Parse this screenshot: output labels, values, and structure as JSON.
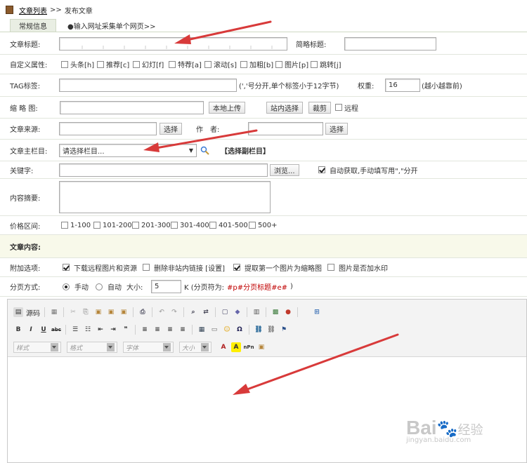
{
  "breadcrumb": {
    "list_link": "文章列表",
    "sep": ">>",
    "current": "发布文章"
  },
  "tabs": [
    {
      "label": "常规信息"
    },
    {
      "label": "●输入网址采集单个网页>>"
    }
  ],
  "fields": {
    "title_label": "文章标题:",
    "short_title_label": "简略标题:",
    "custom_attr_label": "自定义属性:",
    "attrs": [
      "头条[h]",
      "推荐[c]",
      "幻灯[f]",
      "特荐[a]",
      "滚动[s]",
      "加粗[b]",
      "图片[p]",
      "跳转[j]"
    ],
    "tag_label": "TAG标签:",
    "tag_hint": "(','号分开,单个标签小于12字节)",
    "weight_label": "权重:",
    "weight_value": "16",
    "weight_hint": "(越小越靠前)",
    "thumb_label": "缩 略 图:",
    "upload_btn": "本地上传",
    "site_select_btn": "站内选择",
    "crop_btn": "裁剪",
    "remote_label": "远程",
    "source_label": "文章来源:",
    "select_btn": "选择",
    "author_label": "作　者:",
    "category_label": "文章主栏目:",
    "category_value": "请选择栏目...",
    "sub_category_link": "【选择副栏目】",
    "keywords_label": "关键字:",
    "browse_btn": "浏览...",
    "auto_get_label": "自动获取,手动填写用\",\"分开",
    "summary_label": "内容摘要:",
    "price_label": "价格区间:",
    "prices": [
      "1-100",
      "101-200",
      "201-300",
      "301-400",
      "401-500",
      "500+"
    ],
    "content_section": "文章内容:",
    "extra_label": "附加选项:",
    "extras": [
      {
        "label": "下载远程图片和资源",
        "checked": true
      },
      {
        "label": "删除非站内链接 [设置]",
        "checked": false
      },
      {
        "label": "提取第一个图片为缩略图",
        "checked": true
      },
      {
        "label": "图片是否加水印",
        "checked": false
      }
    ],
    "paging_label": "分页方式:",
    "paging_manual": "手动",
    "paging_auto": "自动",
    "size_label": "大小:",
    "size_value": "5",
    "size_unit": "K (分页符为:",
    "page_marker": "#p#分页标题#e#",
    "size_close": ")"
  },
  "editor": {
    "source_btn": "源码",
    "combos": [
      "样式",
      "格式",
      "字体",
      "大小"
    ]
  },
  "watermark": {
    "brand": "Bai",
    "brand2": "经验",
    "url": "jingyan.baidu.com"
  }
}
